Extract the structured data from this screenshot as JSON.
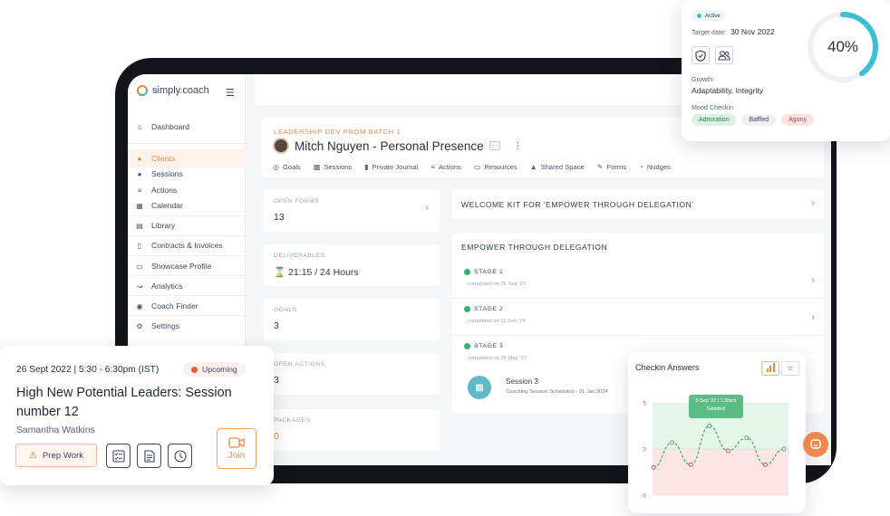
{
  "app": {
    "logo_text": "simply.coach"
  },
  "sidebar": {
    "items": [
      {
        "label": "Dashboard",
        "icon": "home-icon"
      },
      {
        "label": "Clients",
        "icon": "person-icon"
      },
      {
        "label": "Sessions",
        "icon": "handshake-icon"
      },
      {
        "label": "Actions",
        "icon": "list-icon"
      },
      {
        "label": "Calendar",
        "icon": "calendar-icon"
      },
      {
        "label": "Library",
        "icon": "library-icon"
      },
      {
        "label": "Contracts & Invoices",
        "icon": "document-icon"
      },
      {
        "label": "Showcase Profile",
        "icon": "profile-card-icon"
      },
      {
        "label": "Analytics",
        "icon": "analytics-icon"
      },
      {
        "label": "Coach Finder",
        "icon": "search-person-icon"
      },
      {
        "label": "Settings",
        "icon": "gear-icon"
      }
    ],
    "active": "Clients"
  },
  "client": {
    "eyebrow": "LEADERSHIP DEV PROM BATCH 1",
    "name": "Mitch Nguyen - Personal Presence",
    "tabs": [
      {
        "label": "Goals",
        "icon": "target-icon"
      },
      {
        "label": "Sessions",
        "icon": "handshake-icon"
      },
      {
        "label": "Private Journal",
        "icon": "journal-icon"
      },
      {
        "label": "Actions",
        "icon": "list-icon"
      },
      {
        "label": "Resources",
        "icon": "folder-icon"
      },
      {
        "label": "Shared Space",
        "icon": "shared-space-icon"
      },
      {
        "label": "Forms",
        "icon": "forms-icon"
      },
      {
        "label": "Nudges",
        "icon": "nudge-icon"
      }
    ]
  },
  "stats": [
    {
      "label": "OPEN FORMS",
      "value": "13"
    },
    {
      "label": "DELIVERABLES",
      "value": "21:15 / 24 Hours"
    },
    {
      "label": "GOALS",
      "value": "3"
    },
    {
      "label": "OPEN ACTIONS",
      "value": "3"
    },
    {
      "label": "PACKAGES",
      "value": "0"
    }
  ],
  "welcome_kit": {
    "title": "WELCOME KIT FOR 'EMPOWER THROUGH DELEGATION'"
  },
  "empower": {
    "title": "EMPOWER THROUGH DELEGATION",
    "stages": [
      {
        "title": "STAGE 1",
        "sub": "completed on 26 Sep '23"
      },
      {
        "title": "STAGE 2",
        "sub": "completed on 12 Feb '24"
      },
      {
        "title": "STAGE 3",
        "sub": "completed on 26 May '23"
      }
    ],
    "session": {
      "title": "Session 3",
      "sub": "Coaching Session Scheduled - 31 Jan 2024"
    }
  },
  "goal_card": {
    "status": "Active",
    "target_label": "Target date:",
    "target_date": "30 Nov 2022",
    "progress_text": "40%",
    "progress": 0.4,
    "growth_label": "Growth",
    "growth_value": "Adaptability, Integrity",
    "mood_label": "Mood Checkin",
    "moods": [
      {
        "label": "Admiration",
        "bg": "#d9f2e1",
        "fg": "#2a7a4a"
      },
      {
        "label": "Baffled",
        "bg": "#eef0f3",
        "fg": "#3a4658"
      },
      {
        "label": "Agony",
        "bg": "#fde2e2",
        "fg": "#b23a3a"
      }
    ],
    "icons": [
      "shield-icon",
      "people-icon"
    ],
    "colors": {
      "ring": "#3cbfd6",
      "ring_track": "#edf1f4"
    }
  },
  "session_card": {
    "datetime": "26 Sept 2022 | 5:30 - 6:30pm (IST)",
    "status": "Upcoming",
    "title": "High New Potential Leaders: Session number 12",
    "person": "Samantha Watkins",
    "prep_label": "Prep Work",
    "join_label": "Join",
    "icons": [
      "checklist-icon",
      "notes-icon",
      "clock-icon"
    ],
    "colors": {
      "accent": "#e98a3d"
    }
  },
  "checkin": {
    "title": "Checkin Answers",
    "tooltip_date": "5 Sep '22 | 1:30pm",
    "tooltip_value": "Satisfied"
  },
  "chart_data": {
    "type": "line",
    "title": "Checkin Answers",
    "ylim": [
      -5,
      5
    ],
    "yticks": [
      5,
      0,
      -5
    ],
    "series": [
      {
        "values": [
          -2,
          0.7,
          -1.7,
          2.5,
          -0.2,
          1.2,
          -1.7,
          0
        ]
      }
    ],
    "colors": {
      "positive_zone": "#e4f6ea",
      "negative_zone": "#fbe5e5",
      "line": "#3fae66"
    },
    "grid": true
  }
}
